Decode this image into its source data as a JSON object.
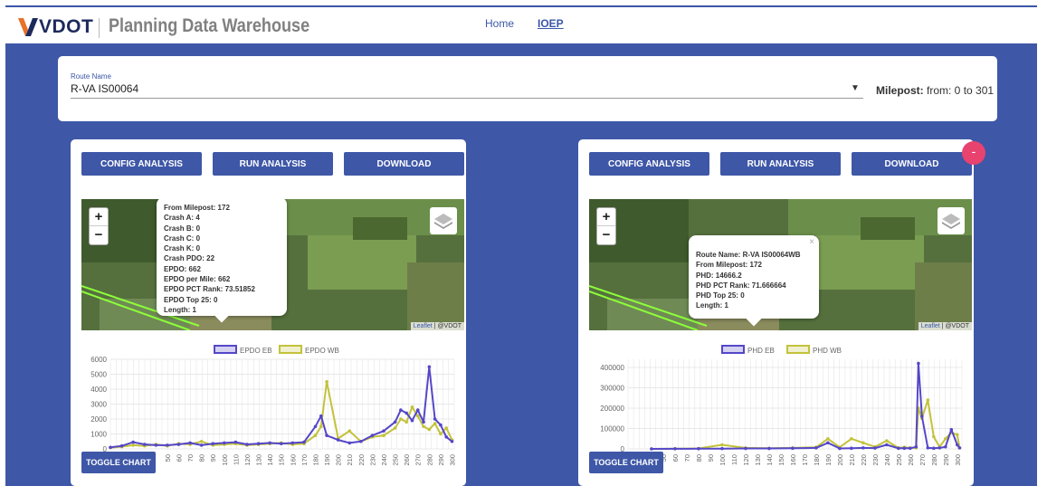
{
  "header": {
    "logo_text": "VDOT",
    "title": "Planning Data Warehouse",
    "nav": [
      "Home",
      "IOEP"
    ]
  },
  "route": {
    "label": "Route Name",
    "value": "R-VA IS00064",
    "milepost_label": "Milepost:",
    "milepost_value": "from: 0 to 301"
  },
  "buttons": {
    "config": "CONFIG ANALYSIS",
    "run": "RUN ANALYSIS",
    "download": "DOWNLOAD",
    "toggle": "TOGGLE CHART",
    "fab": "-"
  },
  "map": {
    "zoom_in": "+",
    "zoom_out": "−",
    "attribution_link": "Leaflet",
    "attribution_text": " | @VDOT"
  },
  "left_popup": [
    "From Milepost: 172",
    "Crash A: 4",
    "Crash B: 0",
    "Crash C: 0",
    "Crash K: 0",
    "Crash PDO: 22",
    "EPDO: 662",
    "EPDO per Mile: 662",
    "EPDO PCT Rank: 73.51852",
    "EPDO Top 25: 0",
    "Length: 1"
  ],
  "right_popup": [
    "Route Name: R-VA IS00064WB",
    "From Milepost: 172",
    "PHD: 14666.2",
    "PHD PCT Rank: 71.666664",
    "PHD Top 25: 0",
    "Length: 1"
  ],
  "right_popup_close": "×",
  "colors": {
    "series_a": "#5547c8",
    "series_b": "#c3c23b",
    "accent": "#3e57a7"
  },
  "chart_data": [
    {
      "type": "line",
      "series": [
        {
          "name": "EPDO EB",
          "x": [
            0,
            10,
            20,
            30,
            40,
            50,
            60,
            70,
            80,
            90,
            100,
            110,
            120,
            130,
            140,
            150,
            160,
            170,
            180,
            185,
            190,
            200,
            210,
            220,
            230,
            240,
            250,
            255,
            260,
            265,
            270,
            275,
            280,
            285,
            290,
            295,
            300
          ],
          "values": [
            100,
            200,
            450,
            300,
            250,
            250,
            300,
            400,
            250,
            350,
            400,
            450,
            300,
            350,
            400,
            350,
            400,
            450,
            1500,
            2200,
            900,
            600,
            400,
            500,
            900,
            1200,
            1800,
            2600,
            2400,
            1900,
            2600,
            1800,
            5500,
            2000,
            1600,
            800,
            500
          ]
        },
        {
          "name": "EPDO WB",
          "x": [
            0,
            10,
            20,
            30,
            40,
            50,
            60,
            70,
            80,
            90,
            100,
            110,
            120,
            130,
            140,
            150,
            160,
            170,
            180,
            185,
            190,
            200,
            210,
            220,
            230,
            240,
            250,
            255,
            260,
            265,
            270,
            275,
            280,
            285,
            290,
            295,
            300
          ],
          "values": [
            80,
            150,
            250,
            200,
            300,
            200,
            350,
            300,
            500,
            250,
            300,
            350,
            250,
            300,
            350,
            400,
            300,
            350,
            900,
            1500,
            4500,
            700,
            1200,
            500,
            800,
            900,
            1400,
            2000,
            1800,
            2800,
            2200,
            1500,
            1300,
            1700,
            1000,
            1400,
            600
          ]
        }
      ],
      "y_ticks": [
        0,
        1000,
        2000,
        3000,
        4000,
        5000,
        6000
      ],
      "x_ticks": [
        50,
        60,
        70,
        80,
        90,
        100,
        110,
        120,
        130,
        140,
        150,
        160,
        170,
        180,
        190,
        200,
        210,
        220,
        230,
        240,
        250,
        260,
        270,
        280,
        290,
        300
      ],
      "ylim": [
        0,
        6000
      ]
    },
    {
      "type": "line",
      "series": [
        {
          "name": "PHD EB",
          "x": [
            40,
            60,
            80,
            100,
            120,
            140,
            160,
            180,
            190,
            200,
            210,
            220,
            230,
            240,
            250,
            255,
            260,
            265,
            267,
            270,
            275,
            280,
            285,
            290,
            295,
            300,
            302
          ],
          "values": [
            0,
            500,
            1000,
            1500,
            2000,
            2000,
            3000,
            5000,
            30000,
            2000,
            3000,
            5000,
            4000,
            20000,
            3000,
            3000,
            3000,
            10000,
            420000,
            160000,
            5000,
            3000,
            5000,
            10000,
            95000,
            20000,
            5000
          ]
        },
        {
          "name": "PHD WB",
          "x": [
            40,
            60,
            80,
            100,
            120,
            140,
            160,
            180,
            190,
            200,
            210,
            220,
            230,
            240,
            250,
            255,
            260,
            265,
            267,
            270,
            275,
            280,
            285,
            290,
            295,
            300,
            302
          ],
          "values": [
            0,
            1000,
            2000,
            20000,
            5000,
            3000,
            5000,
            8000,
            50000,
            8000,
            50000,
            30000,
            10000,
            40000,
            5000,
            8000,
            5000,
            5000,
            200000,
            150000,
            240000,
            60000,
            10000,
            50000,
            80000,
            70000,
            5000
          ]
        }
      ],
      "y_ticks": [
        0,
        100000,
        200000,
        300000,
        400000
      ],
      "x_ticks": [
        40,
        50,
        60,
        70,
        80,
        90,
        100,
        110,
        120,
        130,
        140,
        150,
        160,
        170,
        180,
        190,
        200,
        210,
        220,
        230,
        240,
        250,
        260,
        270,
        280,
        290,
        300
      ],
      "ylim": [
        0,
        440000
      ]
    }
  ]
}
